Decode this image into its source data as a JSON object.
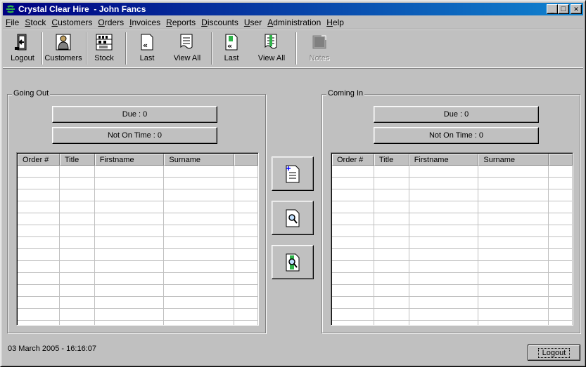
{
  "window": {
    "title": "Crystal Clear Hire  - John Fancs",
    "minimize_glyph": "_",
    "maximize_glyph": "□",
    "close_glyph": "✕"
  },
  "menu": [
    {
      "first": "F",
      "rest": "ile"
    },
    {
      "first": "S",
      "rest": "tock"
    },
    {
      "first": "C",
      "rest": "ustomers"
    },
    {
      "first": "O",
      "rest": "rders"
    },
    {
      "first": "I",
      "rest": "nvoices"
    },
    {
      "first": "R",
      "rest": "eports"
    },
    {
      "first": "D",
      "rest": "iscounts"
    },
    {
      "first": "U",
      "rest": "ser"
    },
    {
      "first": "A",
      "rest": "dministration"
    },
    {
      "first": "H",
      "rest": "elp"
    }
  ],
  "toolbar": {
    "logout": "Logout",
    "customers": "Customers",
    "stock": "Stock",
    "last_out": "Last",
    "view_all_out": "View All",
    "last_in": "Last",
    "view_all_in": "View All",
    "notes": "Notes"
  },
  "going_out": {
    "label": "Going Out",
    "due": "Due : 0",
    "not_on_time": "Not On Time : 0",
    "columns": [
      "Order #",
      "Title",
      "Firstname",
      "Surname",
      ""
    ]
  },
  "coming_in": {
    "label": "Coming In",
    "due": "Due : 0",
    "not_on_time": "Not On Time : 0",
    "columns": [
      "Order #",
      "Title",
      "Firstname",
      "Surname",
      ""
    ]
  },
  "center_buttons": {
    "new_icon": "new-document-icon",
    "find_icon": "magnifier-document-icon",
    "find_green_icon": "magnifier-green-icon"
  },
  "status": {
    "datetime": "03 March 2005 - 16:16:07",
    "logout_label": "Logout"
  },
  "colors": {
    "titlebar_start": "#000080",
    "titlebar_end": "#1084d0",
    "face": "#c0c0c0"
  }
}
